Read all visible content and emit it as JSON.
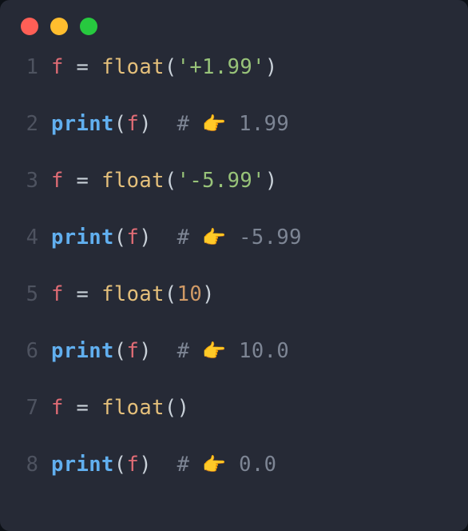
{
  "window": {
    "dot_colors": [
      "#ff5f56",
      "#ffbd2e",
      "#27c93f"
    ]
  },
  "code_lines": [
    {
      "n": "1",
      "tokens": [
        {
          "t": "f",
          "c": "v-name"
        },
        {
          "t": " ",
          "c": "op"
        },
        {
          "t": "=",
          "c": "op"
        },
        {
          "t": " ",
          "c": "op"
        },
        {
          "t": "float",
          "c": "fn-call"
        },
        {
          "t": "(",
          "c": "paren"
        },
        {
          "t": "'+1.99'",
          "c": "str"
        },
        {
          "t": ")",
          "c": "paren"
        }
      ]
    },
    {
      "n": "2",
      "tokens": [
        {
          "t": "print",
          "c": "fn-builtin"
        },
        {
          "t": "(",
          "c": "paren"
        },
        {
          "t": "f",
          "c": "v-name"
        },
        {
          "t": ")",
          "c": "paren"
        },
        {
          "t": "  ",
          "c": "cmt"
        },
        {
          "t": "# ",
          "c": "cmt"
        },
        {
          "t": "👉",
          "c": "emoji"
        },
        {
          "t": " 1.99",
          "c": "cmt"
        }
      ]
    },
    {
      "n": "3",
      "tokens": [
        {
          "t": "f",
          "c": "v-name"
        },
        {
          "t": " ",
          "c": "op"
        },
        {
          "t": "=",
          "c": "op"
        },
        {
          "t": " ",
          "c": "op"
        },
        {
          "t": "float",
          "c": "fn-call"
        },
        {
          "t": "(",
          "c": "paren"
        },
        {
          "t": "'-5.99'",
          "c": "str"
        },
        {
          "t": ")",
          "c": "paren"
        }
      ]
    },
    {
      "n": "4",
      "tokens": [
        {
          "t": "print",
          "c": "fn-builtin"
        },
        {
          "t": "(",
          "c": "paren"
        },
        {
          "t": "f",
          "c": "v-name"
        },
        {
          "t": ")",
          "c": "paren"
        },
        {
          "t": "  ",
          "c": "cmt"
        },
        {
          "t": "# ",
          "c": "cmt"
        },
        {
          "t": "👉",
          "c": "emoji"
        },
        {
          "t": " -5.99",
          "c": "cmt"
        }
      ]
    },
    {
      "n": "5",
      "tokens": [
        {
          "t": "f",
          "c": "v-name"
        },
        {
          "t": " ",
          "c": "op"
        },
        {
          "t": "=",
          "c": "op"
        },
        {
          "t": " ",
          "c": "op"
        },
        {
          "t": "float",
          "c": "fn-call"
        },
        {
          "t": "(",
          "c": "paren"
        },
        {
          "t": "10",
          "c": "num"
        },
        {
          "t": ")",
          "c": "paren"
        }
      ]
    },
    {
      "n": "6",
      "tokens": [
        {
          "t": "print",
          "c": "fn-builtin"
        },
        {
          "t": "(",
          "c": "paren"
        },
        {
          "t": "f",
          "c": "v-name"
        },
        {
          "t": ")",
          "c": "paren"
        },
        {
          "t": "  ",
          "c": "cmt"
        },
        {
          "t": "# ",
          "c": "cmt"
        },
        {
          "t": "👉",
          "c": "emoji"
        },
        {
          "t": " 10.0",
          "c": "cmt"
        }
      ]
    },
    {
      "n": "7",
      "tokens": [
        {
          "t": "f",
          "c": "v-name"
        },
        {
          "t": " ",
          "c": "op"
        },
        {
          "t": "=",
          "c": "op"
        },
        {
          "t": " ",
          "c": "op"
        },
        {
          "t": "float",
          "c": "fn-call"
        },
        {
          "t": "(",
          "c": "paren"
        },
        {
          "t": ")",
          "c": "paren"
        }
      ]
    },
    {
      "n": "8",
      "tokens": [
        {
          "t": "print",
          "c": "fn-builtin"
        },
        {
          "t": "(",
          "c": "paren"
        },
        {
          "t": "f",
          "c": "v-name"
        },
        {
          "t": ")",
          "c": "paren"
        },
        {
          "t": "  ",
          "c": "cmt"
        },
        {
          "t": "# ",
          "c": "cmt"
        },
        {
          "t": "👉",
          "c": "emoji"
        },
        {
          "t": " 0.0",
          "c": "cmt"
        }
      ]
    }
  ]
}
